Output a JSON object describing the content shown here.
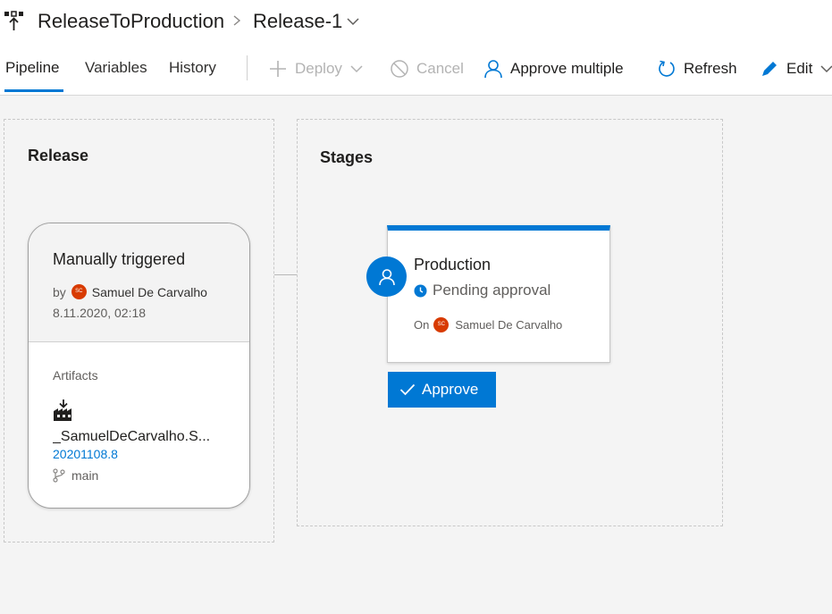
{
  "breadcrumb": {
    "pipeline_name": "ReleaseToProduction",
    "release_name": "Release-1"
  },
  "tabs": [
    {
      "label": "Pipeline",
      "active": true
    },
    {
      "label": "Variables",
      "active": false
    },
    {
      "label": "History",
      "active": false
    }
  ],
  "toolbar": {
    "deploy_label": "Deploy",
    "cancel_label": "Cancel",
    "approve_multiple_label": "Approve multiple",
    "refresh_label": "Refresh",
    "edit_label": "Edit"
  },
  "release_panel": {
    "title": "Release",
    "trigger": "Manually triggered",
    "by_prefix": "by",
    "user_initials": "SC",
    "user_name": "Samuel De Carvalho",
    "date": "8.11.2020, 02:18",
    "artifacts_heading": "Artifacts",
    "artifact_name": "_SamuelDeCarvalho.S...",
    "artifact_version": "20201108.8",
    "artifact_branch": "main"
  },
  "stages_panel": {
    "title": "Stages",
    "stage_name": "Production",
    "stage_status": "Pending approval",
    "on_prefix": "On",
    "user_initials": "SC",
    "user_name": "Samuel De Carvalho",
    "approve_label": "Approve"
  },
  "colors": {
    "accent": "#0078d4",
    "avatar": "#d83b01",
    "disabled": "#b3b3b3"
  },
  "icons": [
    "pipeline-icon",
    "chevron-right-icon",
    "chevron-down-icon",
    "plus-icon",
    "cancel-icon",
    "person-icon",
    "refresh-icon",
    "pencil-icon",
    "artifact-build-icon",
    "branch-icon",
    "clock-icon",
    "checkmark-icon"
  ]
}
